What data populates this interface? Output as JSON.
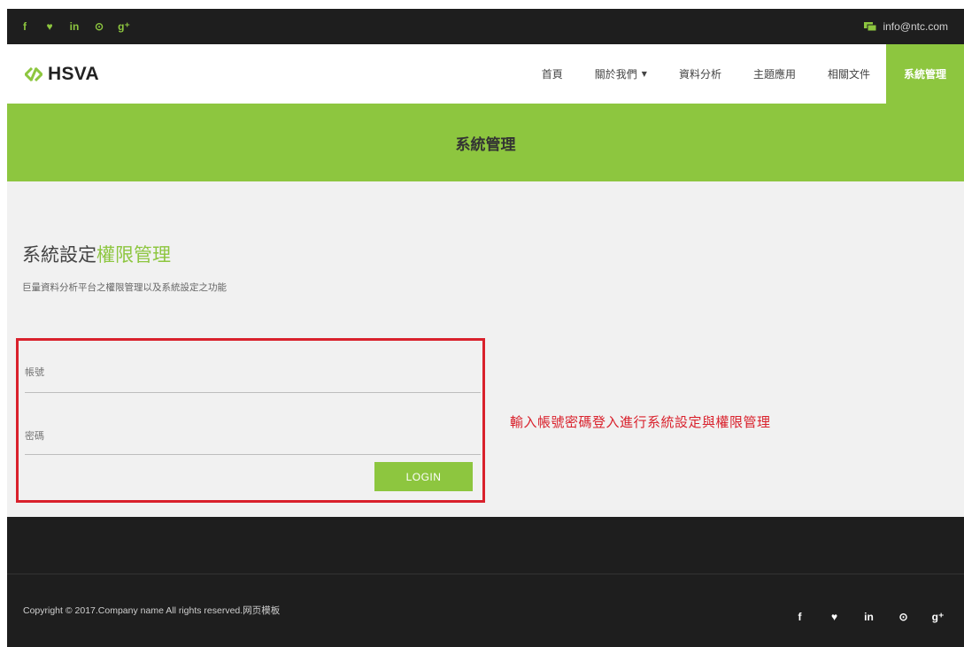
{
  "topbar": {
    "social": [
      {
        "icon": "facebook-icon",
        "glyph": "f"
      },
      {
        "icon": "twitter-icon",
        "glyph": "♥"
      },
      {
        "icon": "linkedin-icon",
        "glyph": "in"
      },
      {
        "icon": "pinterest-icon",
        "glyph": "⊙"
      },
      {
        "icon": "google-plus-icon",
        "glyph": "g⁺"
      }
    ],
    "email": "info@ntc.com"
  },
  "nav": {
    "logo_text": "HSVA",
    "items": [
      "首頁",
      "關於我們",
      "資料分析",
      "主題應用",
      "相關文件",
      "系統管理"
    ],
    "active_index": 5
  },
  "banner": {
    "title": "系統管理"
  },
  "content": {
    "title_main": "系統設定",
    "title_accent": "權限管理",
    "subtitle": "巨量資料分析平台之權限管理以及系統設定之功能"
  },
  "login": {
    "account_label": "帳號",
    "password_label": "密碼",
    "button": "LOGIN"
  },
  "hint": "輸入帳號密碼登入進行系統設定與權限管理",
  "footer": {
    "copyright": "Copyright © 2017.Company name All rights reserved.网页模板"
  },
  "colors": {
    "accent": "#8dc63f",
    "dark": "#1e1e1e",
    "highlight_red": "#d9212c"
  }
}
